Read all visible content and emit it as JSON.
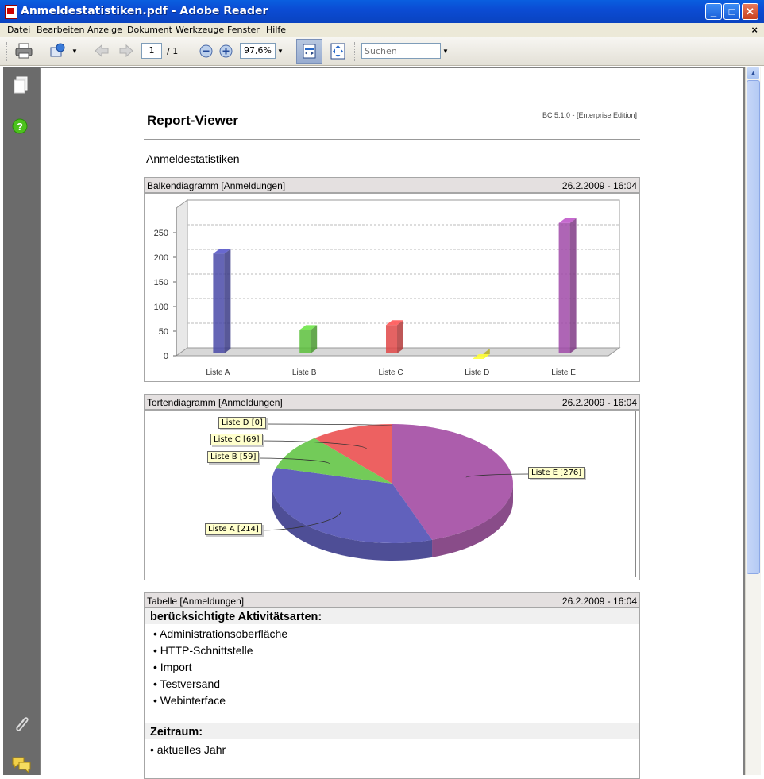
{
  "window": {
    "title": "Anmeldestatistiken.pdf - Adobe Reader"
  },
  "menu": {
    "items": [
      "Datei",
      "Bearbeiten",
      "Anzeige",
      "Dokument",
      "Werkzeuge",
      "Fenster",
      "Hilfe"
    ],
    "close": "×"
  },
  "toolbar": {
    "page_current": "1",
    "page_total": "/ 1",
    "zoom": "97,6%",
    "search_placeholder": "Suchen"
  },
  "report": {
    "header": "Report-Viewer",
    "version": "BC 5.1.0 - [Enterprise Edition]",
    "title": "Anmeldestatistiken",
    "bar_section": {
      "label": "Balkendiagramm [Anmeldungen]",
      "timestamp": "26.2.2009 - 16:04"
    },
    "pie_section": {
      "label": "Tortendiagramm [Anmeldungen]",
      "timestamp": "26.2.2009 - 16:04"
    },
    "table_section": {
      "label": "Tabelle [Anmeldungen]",
      "timestamp": "26.2.2009 - 16:04",
      "activities_heading": "berücksichtigte Aktivitätsarten:",
      "activities": [
        "• Administrationsoberfläche",
        "• HTTP-Schnittstelle",
        "• Import",
        "• Testversand",
        "• Webinterface"
      ],
      "period_heading": "Zeitraum:",
      "period": "• aktuelles Jahr"
    }
  },
  "chart_data": [
    {
      "type": "bar",
      "categories": [
        "Liste A",
        "Liste B",
        "Liste C",
        "Liste D",
        "Liste E"
      ],
      "values": [
        214,
        59,
        69,
        0,
        276
      ],
      "colors": [
        "#4a4aa8",
        "#5cbf3c",
        "#e04848",
        "#e8e030",
        "#a04aa8"
      ],
      "ylim": [
        0,
        300
      ],
      "yticks": [
        0,
        50,
        100,
        150,
        200,
        250
      ],
      "grid": true
    },
    {
      "type": "pie",
      "labels": [
        "Liste A [214]",
        "Liste B [59]",
        "Liste C [69]",
        "Liste D [0]",
        "Liste E [276]"
      ],
      "values": [
        214,
        59,
        69,
        0,
        276
      ],
      "colors": [
        "#5858b8",
        "#6cc850",
        "#ec5858",
        "#e8e030",
        "#a854a8"
      ]
    }
  ]
}
